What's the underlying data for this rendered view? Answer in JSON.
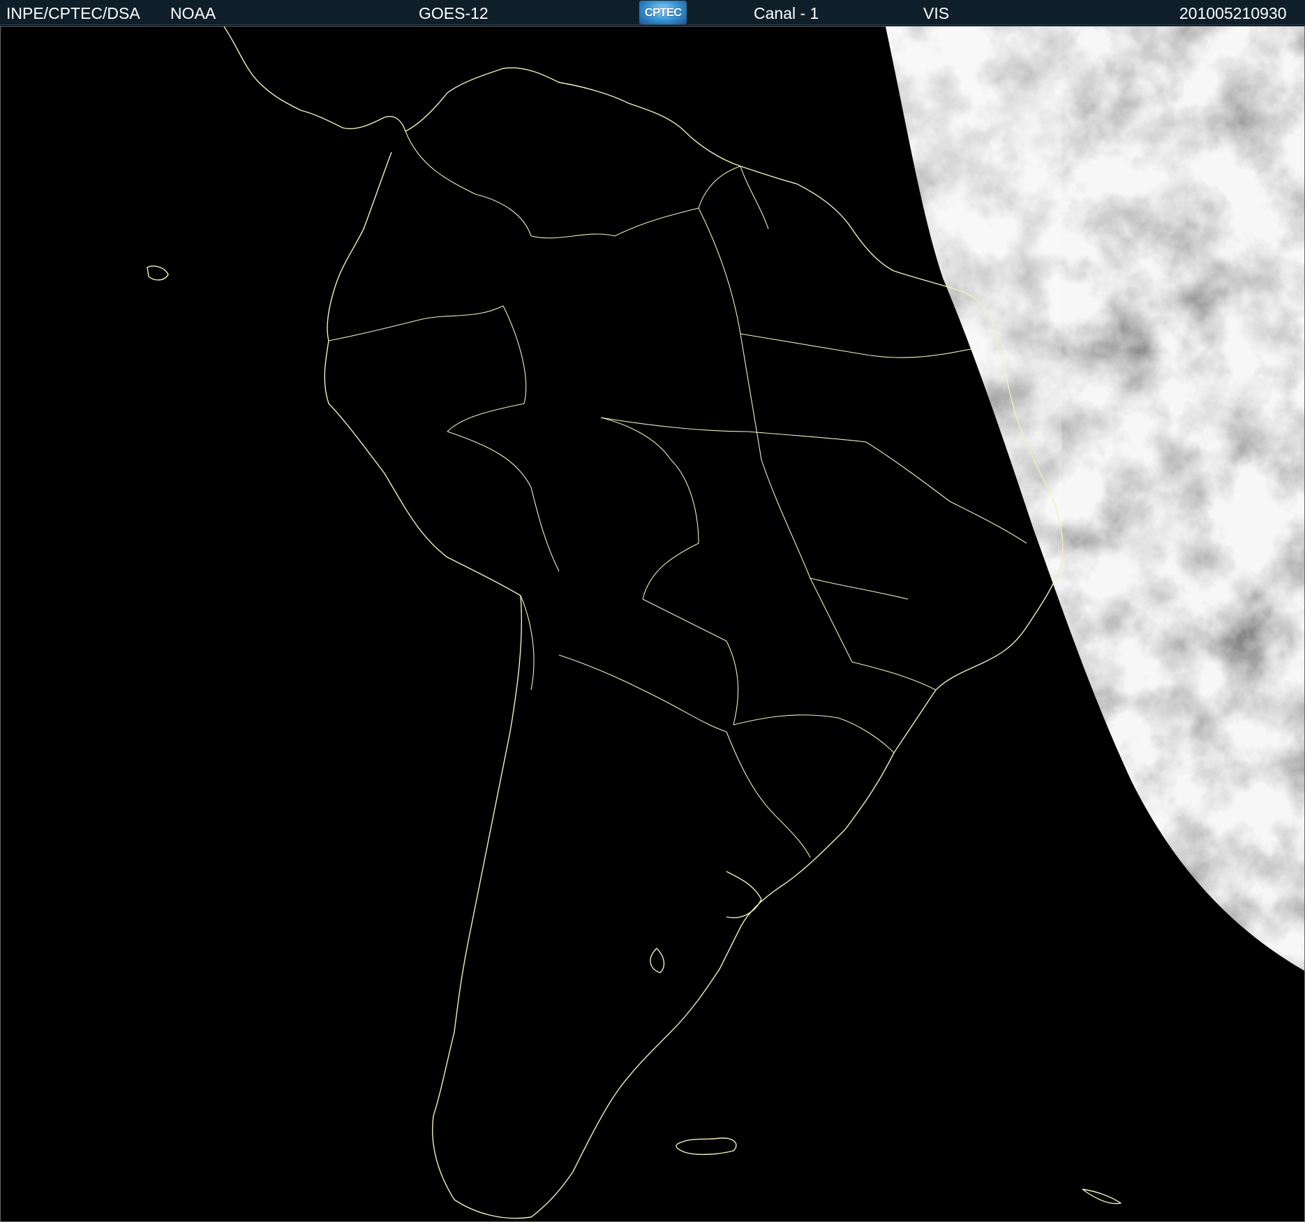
{
  "header": {
    "agency": "INPE/CPTEC/DSA",
    "source": "NOAA",
    "satellite": "GOES-12",
    "logo_text": "CPTEC",
    "channel": "Canal - 1",
    "band": "VIS",
    "timestamp": "201005210930"
  },
  "colors": {
    "header_bg": "#0f1f2a",
    "border_lines": "#f3f0c0",
    "space": "#000000"
  },
  "image": {
    "description_icon": "satellite-visible-image",
    "coastline_color": "#f3f0c0"
  }
}
